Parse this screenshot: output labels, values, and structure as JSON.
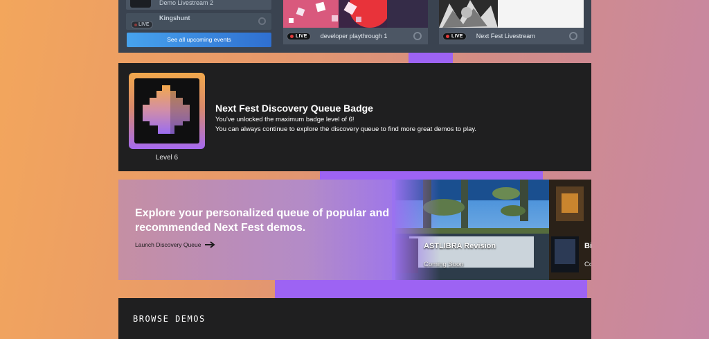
{
  "upcoming_events": {
    "rows": [
      {
        "name": "Demo Livestream 2",
        "live": false
      },
      {
        "name": "Kingshunt",
        "live": true
      }
    ],
    "live_label": "LIVE",
    "see_all_label": "See all upcoming events"
  },
  "live_events": [
    {
      "badge": "LIVE",
      "title": "developer playthrough 1"
    },
    {
      "badge": "LIVE",
      "title": "Next Fest Livestream"
    }
  ],
  "badge": {
    "level_label": "Level 6",
    "title": "Next Fest Discovery Queue Badge",
    "line1": "You've unlocked the maximum badge level of 6!",
    "line2": "You can always continue to explore the discovery queue to find more great demos to play."
  },
  "discovery_queue": {
    "heading": "Explore your personalized queue of popular and recommended Next Fest demos.",
    "launch_label": "Launch Discovery Queue",
    "featured_game": "ASTLIBRA Revision",
    "featured_status": "Coming Soon",
    "next_game_partial": "Bi",
    "next_status_partial": "Co"
  },
  "browse": {
    "title": "BROWSE DEMOS"
  },
  "colors": {
    "accent_purple": "#9d63f3",
    "panel_dark": "#1f1f20",
    "events_panel": "#3a4350",
    "live_dot": "#e23b3b",
    "button_blue": "#3d8be0"
  }
}
